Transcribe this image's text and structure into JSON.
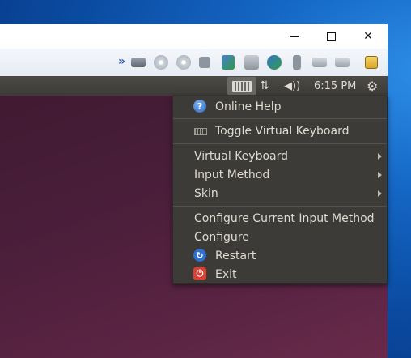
{
  "window": {
    "controls": {
      "minimize": "minimize",
      "maximize": "maximize",
      "close": "✕"
    }
  },
  "toolbar": {
    "overflow": "»",
    "icons": [
      "hard-disk-icon",
      "optical-drive-icon",
      "optical-drive-2-icon",
      "floppy-icon",
      "network-icon",
      "printer-icon",
      "shared-folders-icon",
      "usb-icon",
      "capture-icon",
      "display-icon",
      "clipboard-icon"
    ]
  },
  "panel": {
    "network": "⇅",
    "volume": "◀))",
    "clock": "6:15 PM",
    "settings": "⚙"
  },
  "menu": {
    "items": [
      {
        "label": "Online Help",
        "icon": "help-icon"
      },
      {
        "label": "Toggle Virtual Keyboard",
        "icon": "keyboard-icon"
      },
      {
        "label": "Virtual Keyboard",
        "submenu": true
      },
      {
        "label": "Input Method",
        "submenu": true
      },
      {
        "label": "Skin",
        "submenu": true
      },
      {
        "label": "Configure Current Input Method"
      },
      {
        "label": "Configure"
      },
      {
        "label": "Restart",
        "icon": "restart-icon"
      },
      {
        "label": "Exit",
        "icon": "exit-icon"
      }
    ]
  },
  "colors": {
    "panel_bg": "#3c3b37",
    "menu_text": "#dfdbd2",
    "guest_bg": "#4a1e3a",
    "desktop_bg": "#1466c4"
  }
}
